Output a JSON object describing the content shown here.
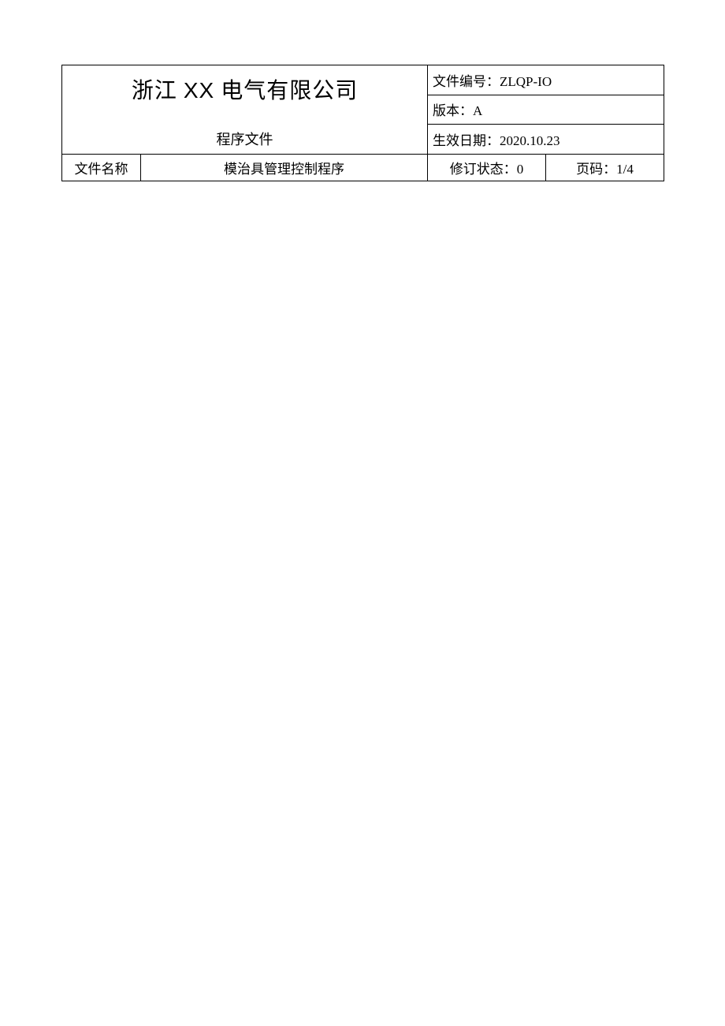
{
  "header": {
    "company_prefix": "浙江 ",
    "company_mid": "XX",
    "company_suffix": " 电气有限公司",
    "doc_type": "程序文件",
    "doc_number": "文件编号：ZLQP-IO",
    "version": "版本：A",
    "effective_date": "生效日期：2020.10.23",
    "file_name_label": "文件名称",
    "file_name_value": "模治具管理控制程序",
    "revision_status": "修订状态：0",
    "page_label": "页码：1/4"
  }
}
